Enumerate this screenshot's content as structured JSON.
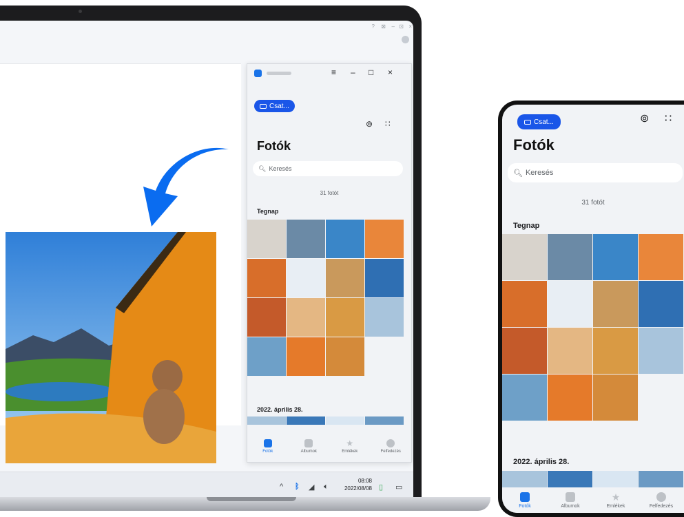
{
  "desktop": {
    "title_controls": [
      "?",
      "⊠",
      "–",
      "⊡",
      "×"
    ],
    "taskbar": {
      "time": "08:08",
      "date": "2022/08/08"
    }
  },
  "gallery": {
    "device_chip": "Csat...",
    "heading": "Fotók",
    "search_placeholder": "Keresés",
    "photo_count": "31 fotót",
    "section_yesterday": "Tegnap",
    "section_date": "2022. április 28.",
    "nav": [
      "Fotók",
      "Albumok",
      "Emlékek",
      "Felfedezés"
    ]
  },
  "photo_colors": [
    "#d8d3cc",
    "#6b8aa6",
    "#3a86c8",
    "#e9863a",
    "#d86e2a",
    "#e8eef4",
    "#c9995c",
    "#2f6fb3",
    "#c45a2a",
    "#e4b783",
    "#d99a44",
    "#a8c4dc",
    "#6ea0c8",
    "#e57a2a",
    "#d48a3a"
  ],
  "colors": {
    "accent": "#1a56e8",
    "arrow": "#0a6cf0"
  }
}
